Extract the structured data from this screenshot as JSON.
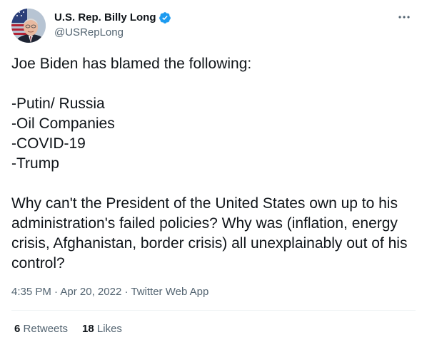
{
  "author": {
    "display_name": "U.S. Rep. Billy Long",
    "handle": "@USRepLong",
    "verified": true
  },
  "tweet": {
    "text": "Joe Biden has blamed the following:\n\n-Putin/ Russia\n-Oil Companies\n-COVID-19\n-Trump\n\nWhy can't the President of the United States own up to his administration's failed policies? Why was (inflation, energy crisis, Afghanistan, border crisis) all unexplainably out of his control?",
    "time": "4:35 PM",
    "date": "Apr 20, 2022",
    "separator": "·",
    "source": "Twitter Web App"
  },
  "stats": {
    "retweets_count": "6",
    "retweets_label": "Retweets",
    "likes_count": "18",
    "likes_label": "Likes"
  },
  "icons": {
    "verified": "verified-badge-icon",
    "more": "more-options-icon"
  },
  "colors": {
    "text": "#0f1419",
    "secondary": "#536471",
    "verified": "#1d9bf0",
    "divider": "#eff3f4"
  }
}
